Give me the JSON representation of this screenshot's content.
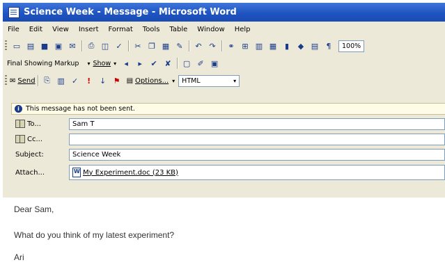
{
  "window": {
    "title": "Science Week - Message - Microsoft Word"
  },
  "menu": [
    "File",
    "Edit",
    "View",
    "Insert",
    "Format",
    "Tools",
    "Table",
    "Window",
    "Help"
  ],
  "standard_toolbar": {
    "zoom": "100%"
  },
  "reviewing_toolbar": {
    "display_for_review": "Final Showing Markup",
    "show_label": "Show"
  },
  "email_toolbar": {
    "send_label": "Send",
    "options_label": "Options...",
    "format": "HTML"
  },
  "infobar": {
    "text": "This message has not been sent."
  },
  "header": {
    "to_label": "To...",
    "to_value": "Sam T",
    "cc_label": "Cc...",
    "cc_value": "",
    "subject_label": "Subject:",
    "subject_value": "Science Week",
    "attach_label": "Attach...",
    "attach_value": "My Experiment.doc (23 KB)"
  },
  "message": {
    "greeting": "Dear Sam,",
    "line1": "What do you think of my latest experiment?",
    "signature": "Ari"
  }
}
